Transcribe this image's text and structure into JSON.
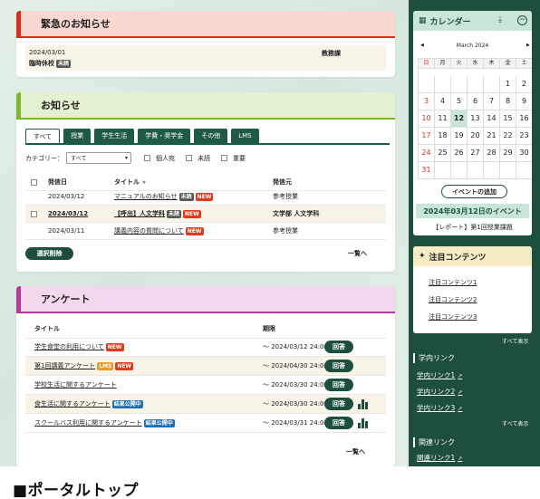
{
  "urgent": {
    "title": "緊急のお知らせ",
    "date": "2024/03/01",
    "item_title": "臨時休校",
    "item_badge": "未読",
    "dept": "教務課"
  },
  "news": {
    "title": "お知らせ",
    "tabs": [
      "すべて",
      "授業",
      "学生生活",
      "学費・奨学金",
      "その他",
      "LMS"
    ],
    "filter_label": "カテゴリー：",
    "filter_value": "すべて",
    "filter_checks": [
      "個人宛",
      "未読",
      "重要"
    ],
    "columns": [
      "発信日",
      "タイトル",
      "発信元"
    ],
    "rows": [
      {
        "date": "2024/03/12",
        "title": "マニュアルのお知らせ",
        "badges": [
          "未読",
          "NEW"
        ],
        "sender": "参考授業"
      },
      {
        "date": "2024/03/12",
        "title": "【呼出】人文学科",
        "badges": [
          "未読",
          "NEW"
        ],
        "sender": "文学部 人文学科"
      },
      {
        "date": "2024/03/11",
        "title": "講義内容の質問について",
        "badges": [
          "NEW"
        ],
        "sender": "参考授業"
      }
    ],
    "delete_label": "選択削除",
    "more_label": "一覧へ"
  },
  "survey": {
    "title": "アンケート",
    "columns": [
      "タイトル",
      "期限"
    ],
    "rows": [
      {
        "title": "学生食堂の利用について",
        "badges": [
          "NEW"
        ],
        "period": "〜 2024/03/12 24:00",
        "button": "回答"
      },
      {
        "title": "第1回講義アンケート",
        "badges": [
          "LMS",
          "NEW"
        ],
        "period": "〜 2024/04/30 24:00",
        "button": "回答"
      },
      {
        "title": "学校生活に関するアンケート",
        "badges": [],
        "period": "〜 2024/03/30 24:00",
        "button": "回答"
      },
      {
        "title": "食生活に関するアンケート",
        "badges": [
          "結果公開中"
        ],
        "period": "〜 2024/03/30 24:00",
        "button": "回答"
      },
      {
        "title": "スクールバス利用に関するアンケート",
        "badges": [
          "結果公開中"
        ],
        "period": "〜 2024/03/31 24:00",
        "button": "回答"
      }
    ],
    "more_label": "一覧へ"
  },
  "calendar": {
    "title": "カレンダー",
    "month": "March 2024",
    "prev": "◀",
    "next": "▶",
    "weekdays": [
      "日",
      "月",
      "火",
      "水",
      "木",
      "金",
      "土"
    ],
    "days": [
      "",
      "",
      "",
      "",
      "",
      "1",
      "2",
      "3",
      "4",
      "5",
      "6",
      "7",
      "8",
      "9",
      "10",
      "11",
      "12",
      "13",
      "14",
      "15",
      "16",
      "17",
      "18",
      "19",
      "20",
      "21",
      "22",
      "23",
      "24",
      "25",
      "26",
      "27",
      "28",
      "29",
      "30",
      "31",
      "",
      "",
      "",
      "",
      "",
      ""
    ],
    "today": "12",
    "add_event": "イベントの追加",
    "events_heading": "2024年03月12日のイベント",
    "event": "【レポート】第1回授業課題"
  },
  "featured": {
    "title": "注目コンテンツ",
    "items": [
      "注目コンテンツ1",
      "注目コンテンツ2",
      "注目コンテンツ3"
    ],
    "more_label": "すべて表示"
  },
  "campus_links": {
    "title": "学内リンク",
    "items": [
      "学内リンク1",
      "学内リンク2",
      "学内リンク3"
    ],
    "more_label": "すべて表示"
  },
  "related_links": {
    "title": "関連リンク",
    "items": [
      "関連リンク1"
    ]
  },
  "caption": "■ポータルトップ"
}
